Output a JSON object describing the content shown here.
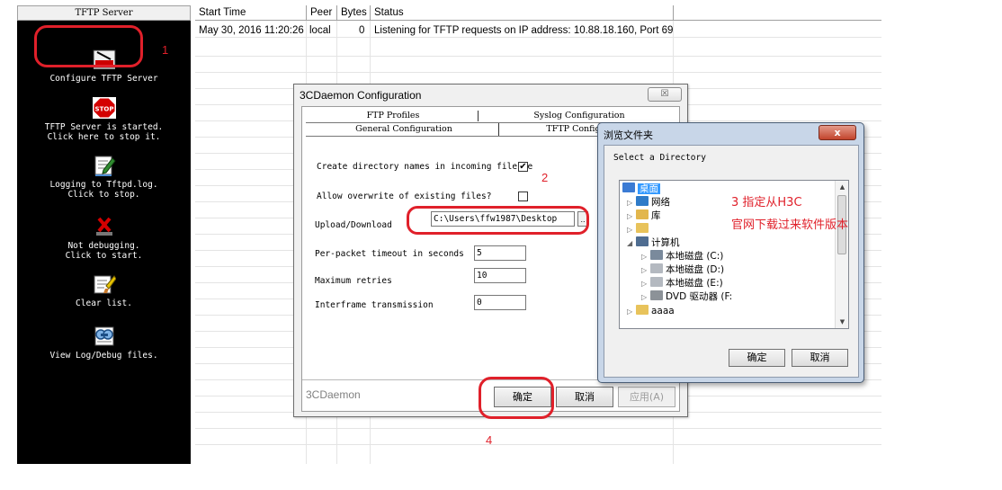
{
  "left_panel": {
    "header": "TFTP Server",
    "items": [
      {
        "label": "Configure TFTP Server",
        "icon": "configure-icon"
      },
      {
        "label": "TFTP Server is started.\nClick here to stop it.",
        "icon": "stop-icon",
        "icon_text": "STOP"
      },
      {
        "label": "Logging to Tftpd.log.\nClick to stop.",
        "icon": "log-pencil-icon"
      },
      {
        "label": "Not debugging.\nClick to start.",
        "icon": "debug-x-icon"
      },
      {
        "label": "Clear list.",
        "icon": "clear-list-icon"
      },
      {
        "label": "View Log/Debug files.",
        "icon": "view-files-icon"
      }
    ]
  },
  "log_table": {
    "columns": [
      "Start Time",
      "Peer",
      "Bytes",
      "Status"
    ],
    "rows": [
      {
        "start_time": "May 30, 2016 11:20:26",
        "peer": "local",
        "bytes": "0",
        "status": "Listening for TFTP requests on IP address: 10.88.18.160, Port 69"
      }
    ]
  },
  "config_dialog": {
    "title": "3CDaemon Configuration",
    "close_glyph": "☒",
    "tabs": [
      "FTP Profiles",
      "Syslog Configuration",
      "General Configuration",
      "TFTP Configuration"
    ],
    "create_dirs_label": "Create directory names in incoming file re",
    "create_dirs_checked": true,
    "check_glyph": "✔",
    "overwrite_label": "Allow overwrite of existing files?",
    "overwrite_checked": false,
    "upload_label": "Upload/Download",
    "upload_path": "C:\\Users\\ffw1987\\Desktop",
    "browse_glyph": "..",
    "timeout_label": "Per-packet timeout in seconds",
    "timeout_value": "5",
    "retries_label": "Maximum retries",
    "retries_value": "10",
    "interframe_label": "Interframe transmission",
    "interframe_value": "0",
    "brand": "3CDaemon",
    "ok_label": "确定",
    "cancel_label": "取消",
    "apply_label": "应用(A)"
  },
  "browse_dialog": {
    "title": "浏览文件夹",
    "close_glyph": "x",
    "prompt": "Select a Directory",
    "tree": [
      {
        "label": "桌面",
        "level": 0,
        "icon": "desktop-icon",
        "expander": "",
        "selected": true
      },
      {
        "label": "网络",
        "level": 1,
        "icon": "network-icon",
        "expander": "▷"
      },
      {
        "label": "库",
        "level": 1,
        "icon": "library-icon",
        "expander": "▷"
      },
      {
        "label": "",
        "level": 1,
        "icon": "user-folder-icon",
        "expander": "▷"
      },
      {
        "label": "计算机",
        "level": 1,
        "icon": "computer-icon",
        "expander": "◢"
      },
      {
        "label": "本地磁盘 (C:)",
        "level": 2,
        "icon": "system-drive-icon",
        "expander": "▷"
      },
      {
        "label": "本地磁盘 (D:)",
        "level": 2,
        "icon": "drive-icon",
        "expander": "▷"
      },
      {
        "label": "本地磁盘 (E:)",
        "level": 2,
        "icon": "drive-icon",
        "expander": "▷"
      },
      {
        "label": "DVD 驱动器 (F:",
        "level": 2,
        "icon": "dvd-drive-icon",
        "expander": "▷"
      },
      {
        "label": "aaaa",
        "level": 1,
        "icon": "folder-icon",
        "expander": "▷"
      }
    ],
    "ok_label": "确定",
    "cancel_label": "取消"
  },
  "annotations": {
    "step1": "1",
    "step2": "2",
    "step3_line1": "3 指定从H3C",
    "step3_line2": "官网下载过来软件版本",
    "step4": "4",
    "color": "#e0202a"
  }
}
